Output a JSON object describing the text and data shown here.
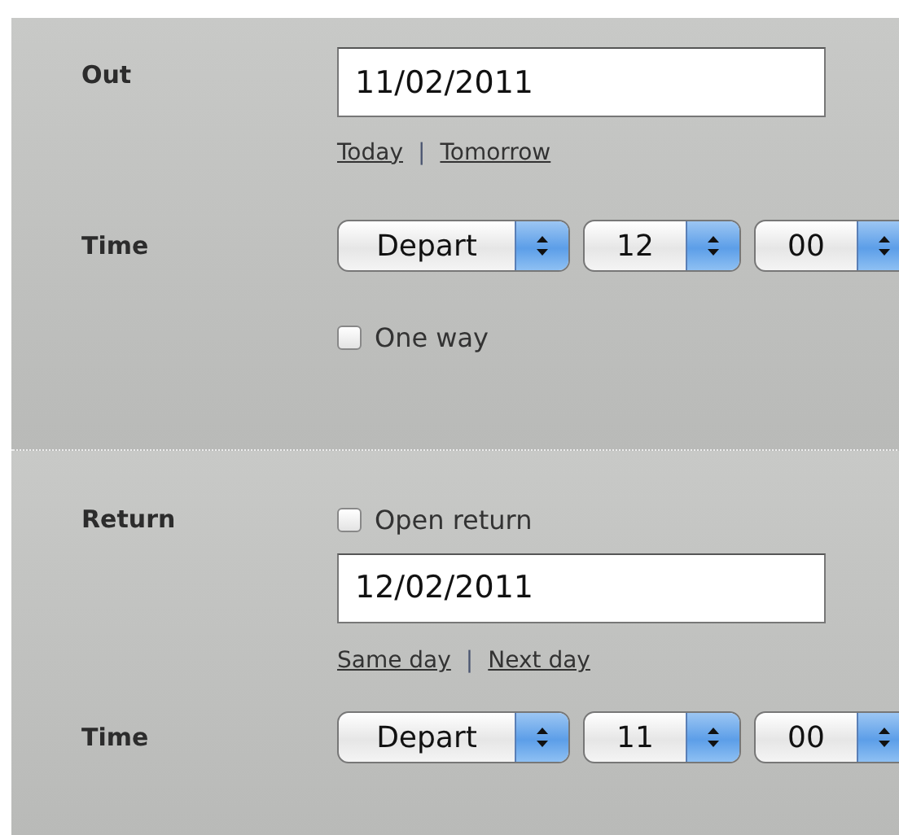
{
  "sections": [
    {
      "kind": "outbound",
      "label": "Out",
      "date": "11/02/2011",
      "links": [
        "Today",
        "Tomorrow"
      ],
      "link_separator": "|",
      "time_label": "Time",
      "selects": [
        "Depart",
        "12",
        "00"
      ],
      "option": {
        "label": "One way",
        "checked": false
      }
    },
    {
      "kind": "return",
      "label": "Return",
      "option": {
        "label": "Open return",
        "checked": false
      },
      "date": "12/02/2011",
      "links": [
        "Same day",
        "Next day"
      ],
      "link_separator": "|",
      "time_label": "Time",
      "selects": [
        "Depart",
        "11",
        "00"
      ]
    }
  ]
}
